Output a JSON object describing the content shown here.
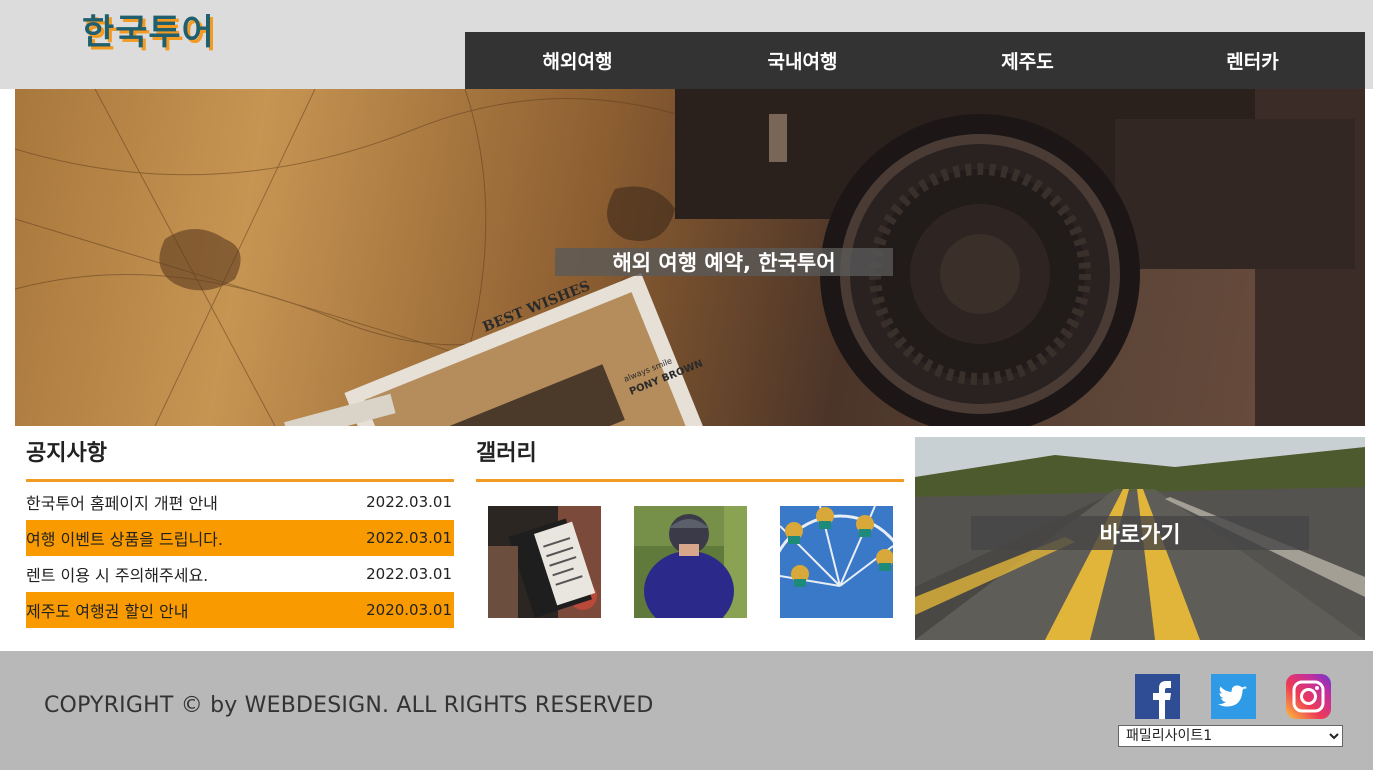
{
  "header": {
    "logo": "한국투어",
    "nav": [
      "해외여행",
      "국내여행",
      "제주도",
      "렌터카"
    ]
  },
  "hero": {
    "caption": "해외 여행 예약, 한국투어",
    "postcard_text": "BEST WISHES",
    "postcard_sub1": "always smile",
    "postcard_sub2": "PONY BROWN"
  },
  "notice": {
    "title": "공지사항",
    "items": [
      {
        "text": "한국투어 홈페이지 개편 안내",
        "date": "2022.03.01",
        "highlight": false
      },
      {
        "text": "여행 이벤트 상품을 드립니다.",
        "date": "2022.03.01",
        "highlight": true
      },
      {
        "text": "렌트 이용 시 주의해주세요.",
        "date": "2022.03.01",
        "highlight": false
      },
      {
        "text": "제주도 여행권 할인 안내",
        "date": "2020.03.01",
        "highlight": true
      }
    ]
  },
  "gallery": {
    "title": "갤러리"
  },
  "shortcut": {
    "label": "바로가기"
  },
  "footer": {
    "copyright": "COPYRIGHT © by WEBDESIGN. ALL RIGHTS RESERVED",
    "family_select": "패밀리사이트1",
    "sns": [
      "facebook-icon",
      "twitter-icon",
      "instagram-icon"
    ]
  },
  "colors": {
    "accent": "#f99b00",
    "nav_bg": "#333333",
    "header_bg": "#dcdcdc",
    "footer_bg": "#b8b8b8"
  }
}
